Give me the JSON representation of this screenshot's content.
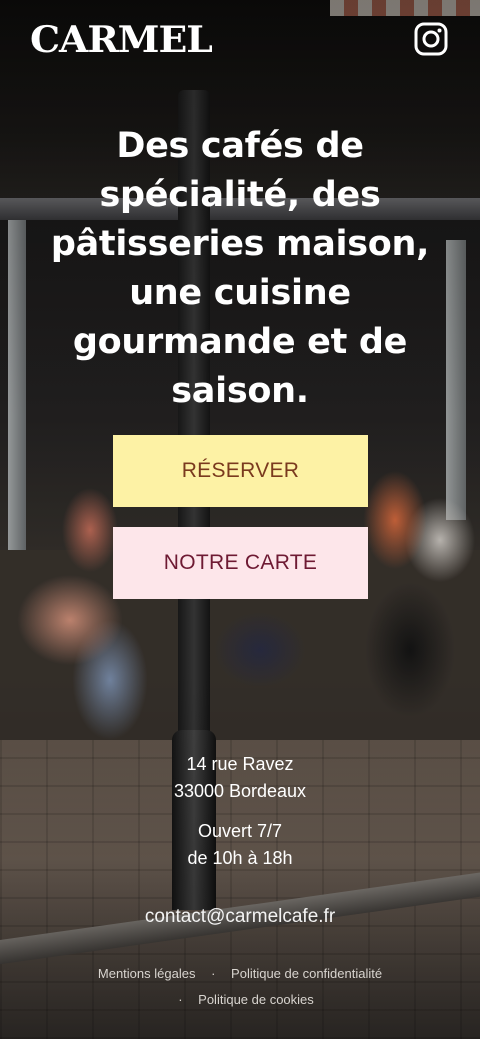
{
  "header": {
    "brand": "CARMEL",
    "social_icon": "instagram-icon"
  },
  "hero": {
    "headline": "Des cafés de spécialité, des pâtisseries maison, une cuisine gourmande et de saison."
  },
  "actions": {
    "reserve_label": "RÉSERVER",
    "menu_label": "NOTRE CARTE"
  },
  "info": {
    "address_line1": "14 rue Ravez",
    "address_line2": "33000 Bordeaux",
    "hours_line1": "Ouvert 7/7",
    "hours_line2": "de 10h à 18h",
    "email": "contact@carmelcafe.fr"
  },
  "footer": {
    "links": [
      "Mentions légales",
      "Politique de confidentialité",
      "Politique de cookies"
    ],
    "separator": "·"
  },
  "colors": {
    "reserve_bg": "#fdf2a5",
    "reserve_text": "#7a3a1e",
    "menu_bg": "#fde6ea",
    "menu_text": "#6e1a33",
    "text": "#ffffff"
  }
}
